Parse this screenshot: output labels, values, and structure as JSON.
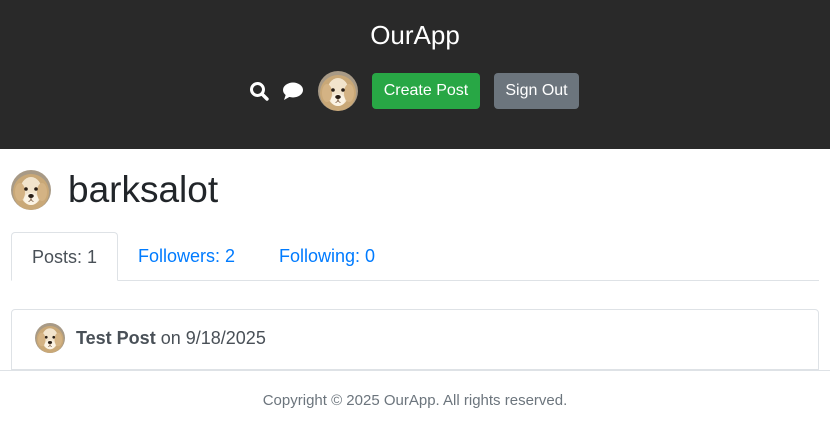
{
  "header": {
    "brand": "OurApp",
    "icons": {
      "search": "search-icon",
      "chat": "chat-bubble-icon"
    },
    "create_post_label": "Create Post",
    "sign_out_label": "Sign Out"
  },
  "profile": {
    "username": "barksalot",
    "avatar": "golden-retriever-avatar"
  },
  "tabs": [
    {
      "label": "Posts: 1",
      "active": true
    },
    {
      "label": "Followers: 2",
      "active": false
    },
    {
      "label": "Following: 0",
      "active": false
    }
  ],
  "posts": [
    {
      "title": "Test Post",
      "connector": "on",
      "date": "9/18/2025"
    }
  ],
  "footer": {
    "copyright": "Copyright © 2025 OurApp. All rights reserved."
  },
  "colors": {
    "header_bg": "#292929",
    "create_button": "#28a745",
    "sign_out_button": "#6c757d",
    "link": "#007bff"
  }
}
